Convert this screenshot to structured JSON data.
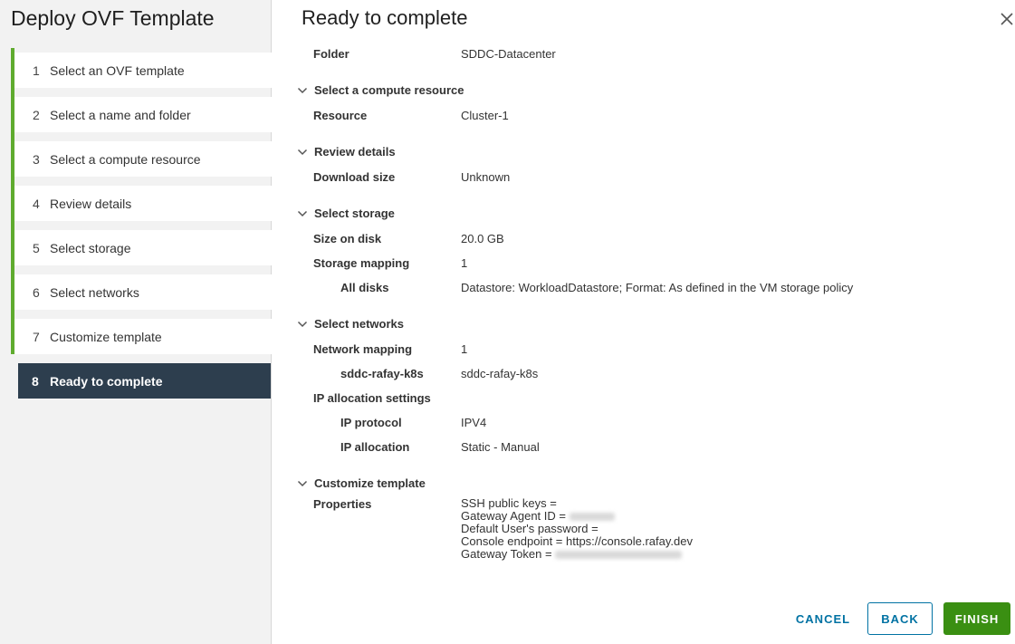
{
  "wizard": {
    "title": "Deploy OVF Template",
    "steps": [
      {
        "num": "1",
        "label": "Select an OVF template"
      },
      {
        "num": "2",
        "label": "Select a name and folder"
      },
      {
        "num": "3",
        "label": "Select a compute resource"
      },
      {
        "num": "4",
        "label": "Review details"
      },
      {
        "num": "5",
        "label": "Select storage"
      },
      {
        "num": "6",
        "label": "Select networks"
      },
      {
        "num": "7",
        "label": "Customize template"
      },
      {
        "num": "8",
        "label": "Ready to complete"
      }
    ],
    "active_step": 8,
    "colors": {
      "complete_bar": "#5fab2e",
      "active_bg": "#2d3e4e",
      "finish": "#3a8f12",
      "link": "#0072a3"
    }
  },
  "main": {
    "title": "Ready to complete",
    "folder": {
      "label": "Folder",
      "value": "SDDC-Datacenter"
    },
    "compute": {
      "title": "Select a compute resource",
      "resource_label": "Resource",
      "resource_value": "Cluster-1"
    },
    "review": {
      "title": "Review details",
      "download_label": "Download size",
      "download_value": "Unknown"
    },
    "storage": {
      "title": "Select storage",
      "size_label": "Size on disk",
      "size_value": "20.0 GB",
      "mapping_label": "Storage mapping",
      "mapping_value": "1",
      "alldisks_label": "All disks",
      "alldisks_value": "Datastore: WorkloadDatastore; Format: As defined in the VM storage policy"
    },
    "networks": {
      "title": "Select networks",
      "mapping_label": "Network mapping",
      "mapping_value": "1",
      "net_label": "sddc-rafay-k8s",
      "net_value": "sddc-rafay-k8s",
      "ipalloc_label": "IP allocation settings",
      "protocol_label": "IP protocol",
      "protocol_value": "IPV4",
      "allocation_label": "IP allocation",
      "allocation_value": "Static - Manual"
    },
    "customize": {
      "title": "Customize template",
      "properties_label": "Properties",
      "lines": [
        "SSH public keys =",
        "Gateway Agent ID =",
        "Default User's password =",
        "Console endpoint = https://console.rafay.dev",
        "Gateway Token ="
      ]
    }
  },
  "footer": {
    "cancel": "CANCEL",
    "back": "BACK",
    "finish": "FINISH"
  },
  "icons": {
    "close": "close-icon",
    "chevron": "chevron-down-icon"
  }
}
